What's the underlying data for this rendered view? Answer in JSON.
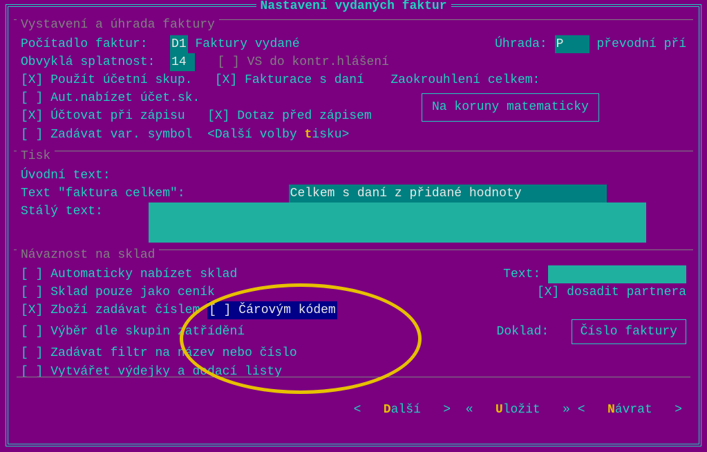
{
  "title": "Nastavení vydaných faktur",
  "section1": {
    "legend": "Vystavení a úhrada faktury",
    "counter_label": "Počítadlo faktur:",
    "counter_val": "D1",
    "counter_desc": "Faktury vydané",
    "payment_label": "Úhrada:",
    "payment_val": "P",
    "payment_desc": "převodní pří",
    "due_label": "Obvyklá splatnost:",
    "due_val": "14",
    "vs_kontr": "VS do kontr.hlášení",
    "use_acct_group": "Použít účetní skup.",
    "tax_invoice": "Fakturace s daní",
    "rounding_label": "Zaokrouhlení celkem:",
    "auto_offer": "Aut.nabízet účet.sk.",
    "book_on_write": "Účtovat při zápisu",
    "confirm_before": "Dotaz před zápisem",
    "rounding_btn": "Na koruny matematicky",
    "enter_vs": "Zadávat var. symbol",
    "more_print_pre": "<Další volby ",
    "more_print_hot": "t",
    "more_print_post": "isku>"
  },
  "section2": {
    "legend": "Tisk",
    "intro_label": "Úvodní text:",
    "intro_val": " ",
    "total_label": "Text \"faktura celkem\":",
    "total_val": "Celkem s daní z přidané hodnoty",
    "perma_label": "Stálý text:"
  },
  "section3": {
    "legend": "Návaznost na sklad",
    "auto_stock": "Automaticky nabízet sklad",
    "text_label": "Text:",
    "price_only": "Sklad pouze jako ceník",
    "fill_partner": "dosadit partnera",
    "goods_by_num": "Zboží zadávat číslem",
    "barcode": "Čárovým kódem",
    "group_select": "Výběr dle skupin zatřídění",
    "doc_label": "Doklad:",
    "doc_btn": "Číslo faktury",
    "name_filter": "Zadávat filtr na název nebo číslo",
    "gen_delivery": "Vytvářet výdejky a dodací listy"
  },
  "footer": {
    "lt": "<",
    "gt": ">",
    "ll": "«",
    "rr": "»",
    "next_hot": "D",
    "next_rest": "alší",
    "save_hot": "U",
    "save_rest": "ložit",
    "back_hot": "N",
    "back_rest": "ávrat"
  }
}
